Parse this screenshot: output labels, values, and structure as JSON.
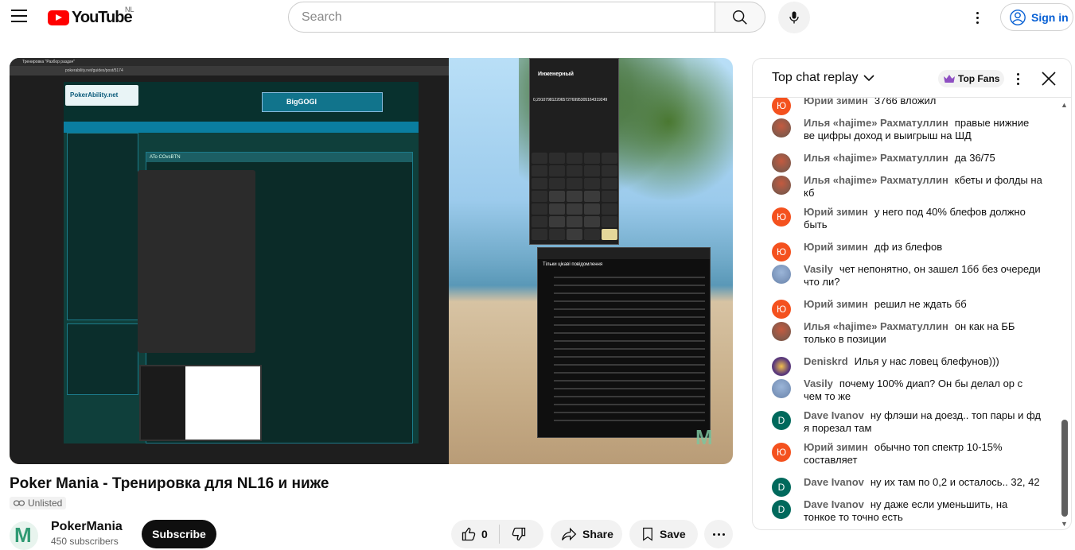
{
  "header": {
    "logo_text": "YouTube",
    "country_code": "NL",
    "search_placeholder": "Search",
    "sign_in_label": "Sign in"
  },
  "video": {
    "title": "Poker Mania - Тренировка для NL16 и ниже",
    "visibility": "Unlisted",
    "screen": {
      "browser_tab": "Тренировка \"Разбор раздач\"",
      "address": "pokerability.net/guides/post/5174",
      "site_logo": "PokerAbility.net",
      "banner": "BigGOGI",
      "section_title": "ATo COvsBTN",
      "calculator_title": "Инженерный",
      "calculator_result": "0,291079812206572769953051643192​49",
      "chat_header": "Тільки цікаві повідомлення"
    }
  },
  "channel": {
    "name": "PokerMania",
    "subscribers": "450 subscribers",
    "subscribe_label": "Subscribe"
  },
  "actions": {
    "like_count": "0",
    "share_label": "Share",
    "save_label": "Save"
  },
  "chat": {
    "title": "Top chat replay",
    "top_fans_label": "Top Fans",
    "messages": [
      {
        "author": "Юрий зимин",
        "text": "3766 вложил",
        "avatar": "yu"
      },
      {
        "author": "Илья «hajime» Рахматуллин",
        "text": "правые нижние ве цифры доход и выигрыш на ШД",
        "avatar": "il"
      },
      {
        "author": "Илья «hajime» Рахматуллин",
        "text": "да 36/75",
        "avatar": "il"
      },
      {
        "author": "Илья «hajime» Рахматуллин",
        "text": "кбеты и фолды на кб",
        "avatar": "il"
      },
      {
        "author": "Юрий зимин",
        "text": "у него под 40% блефов должно быть",
        "avatar": "yu"
      },
      {
        "author": "Юрий зимин",
        "text": "дф из блефов",
        "avatar": "yu"
      },
      {
        "author": "Vasily",
        "text": "чет непонятно, он зашел 1бб без очереди что ли?",
        "avatar": "va"
      },
      {
        "author": "Юрий зимин",
        "text": "решил не ждать бб",
        "avatar": "yu"
      },
      {
        "author": "Илья «hajime» Рахматуллин",
        "text": "он как на ББ только в позиции",
        "avatar": "il"
      },
      {
        "author": "Deniskrd",
        "text": "Илья у нас ловец блефунов)))",
        "avatar": "de"
      },
      {
        "author": "Vasily",
        "text": "почему 100% диап? Он бы делал ор с чем то же",
        "avatar": "va"
      },
      {
        "author": "Dave Ivanov",
        "text": "ну флэши на доезд.. топ пары и фд я порезал там",
        "avatar": "d"
      },
      {
        "author": "Юрий зимин",
        "text": "обычно топ спектр 10-15% составляет",
        "avatar": "yu"
      },
      {
        "author": "Dave Ivanov",
        "text": "ну их там по 0,2 и осталось.. 32, 42",
        "avatar": "d"
      },
      {
        "author": "Dave Ivanov",
        "text": "ну даже если уменьшить, на тонкое то точно есть",
        "avatar": "d"
      }
    ],
    "avatar_letters": {
      "yu": "Ю",
      "d": "D"
    }
  },
  "colors": {
    "brand_red": "#ff0000",
    "link_blue": "#065fd4",
    "avatar_orange": "#f4511e",
    "avatar_teal": "#00695c"
  }
}
